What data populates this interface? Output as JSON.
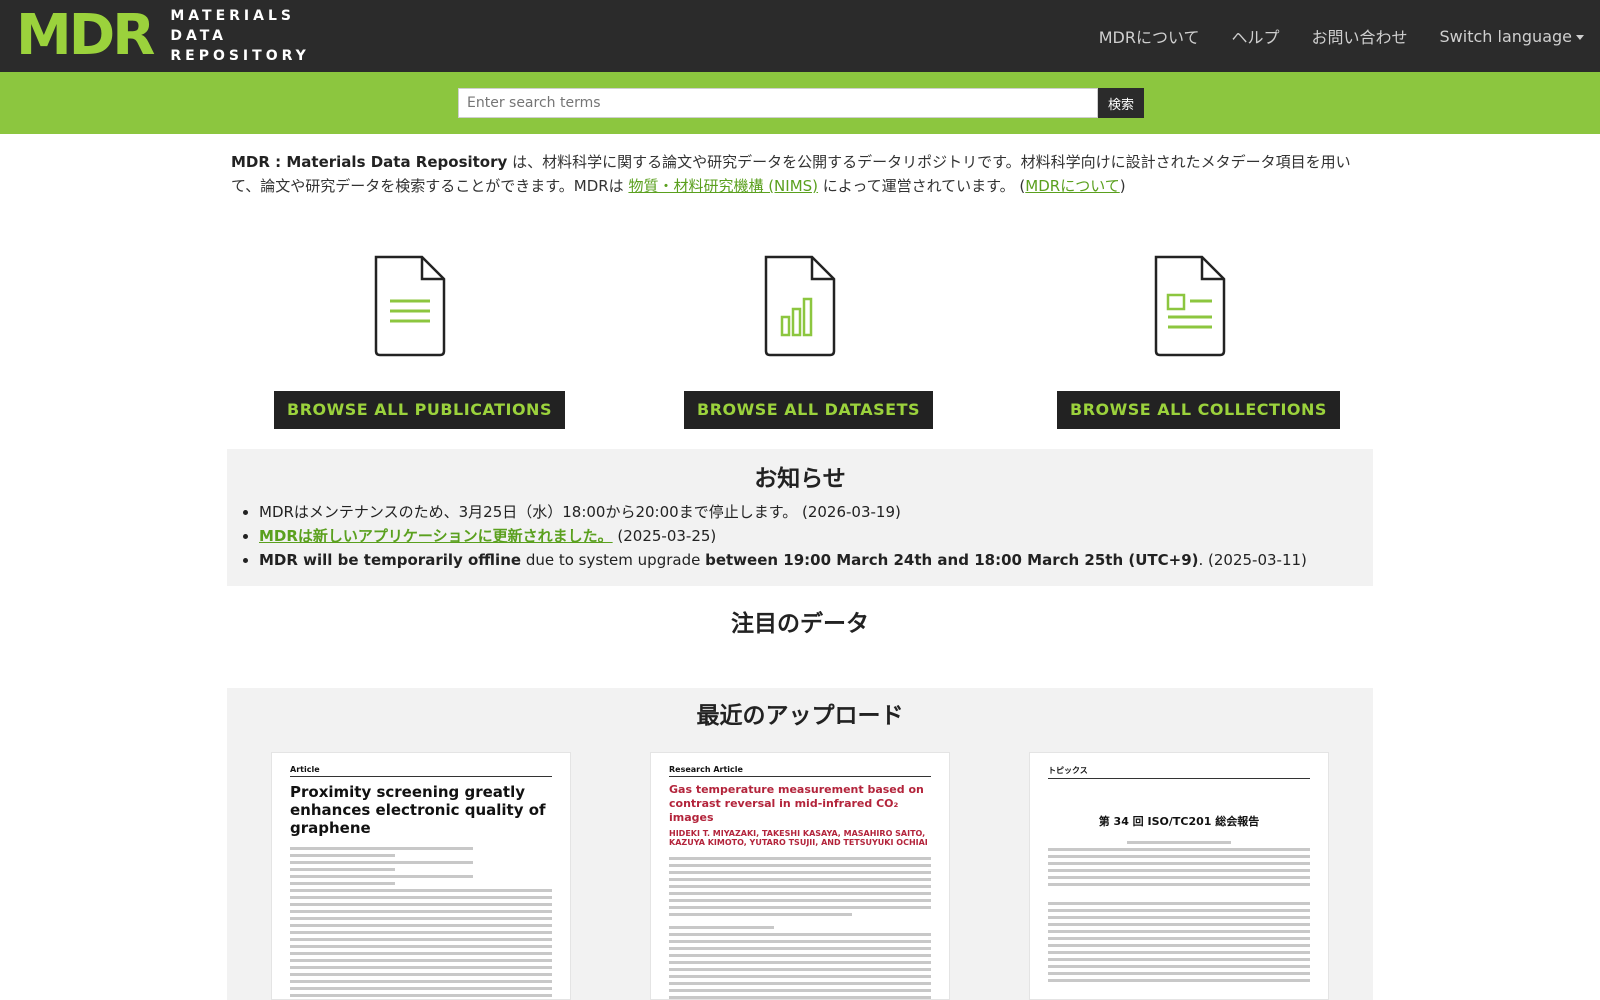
{
  "header": {
    "logo_mark": "MDR",
    "logo_lines": [
      "MATERIALS",
      "DATA",
      "REPOSITORY"
    ],
    "nav": [
      {
        "label": "MDRについて"
      },
      {
        "label": "ヘルプ"
      },
      {
        "label": "お問い合わせ"
      },
      {
        "label": "Switch language"
      }
    ]
  },
  "search": {
    "placeholder": "Enter search terms",
    "button_label": "検索"
  },
  "intro": {
    "brand": "MDR : Materials Data Repository",
    "text1": " は、材料科学に関する論文や研究データを公開するデータリポジトリです。材料科学向けに設計されたメタデータ項目を用いて、論文や研究データを検索することができます。MDRは ",
    "nims_link": "物質・材料研究機構 (NIMS)",
    "text2": " によって運営されています。 (",
    "about_link": "MDRについて",
    "text3": ")"
  },
  "browse": [
    {
      "label": "BROWSE ALL PUBLICATIONS",
      "icon": "document-lines-icon"
    },
    {
      "label": "BROWSE ALL DATASETS",
      "icon": "document-chart-icon"
    },
    {
      "label": "BROWSE ALL COLLECTIONS",
      "icon": "document-layout-icon"
    }
  ],
  "notice": {
    "title": "お知らせ",
    "items": [
      {
        "text": "MDRはメンテナンスのため、3月25日（水）18:00から20:00まで停止します。 (2026-03-19)"
      },
      {
        "link": "MDRは新しいアプリケーションに更新されました。",
        "date": " (2025-03-25)"
      },
      {
        "bold1": "MDR will be temporarily offline",
        "mid": " due to system upgrade ",
        "bold2": "between 19:00 March 24th and 18:00 March 25th (UTC+9)",
        "end": ". (2025-03-11)"
      }
    ]
  },
  "featured": {
    "title": "注目のデータ"
  },
  "recent": {
    "title": "最近のアップロード",
    "items": [
      {
        "kind": "Article",
        "title": "Proximity screening greatly enhances electronic quality of graphene"
      },
      {
        "kind": "Research Article",
        "title": "Gas temperature measurement based on contrast reversal in mid-infrared CO₂ images",
        "authors": "HIDEKI T. MIYAZAKI, TAKESHI KASAYA, MASAHIRO SAITO, KAZUYA KIMOTO, YUTARO TSUJII, AND TETSUYUKI OCHIAI"
      },
      {
        "kind": "トピックス",
        "title": "第 34 回 ISO/TC201 総会報告"
      }
    ]
  },
  "colors": {
    "accent": "#8cc63f",
    "dark": "#2b2b2b",
    "link": "#5aa01e"
  }
}
